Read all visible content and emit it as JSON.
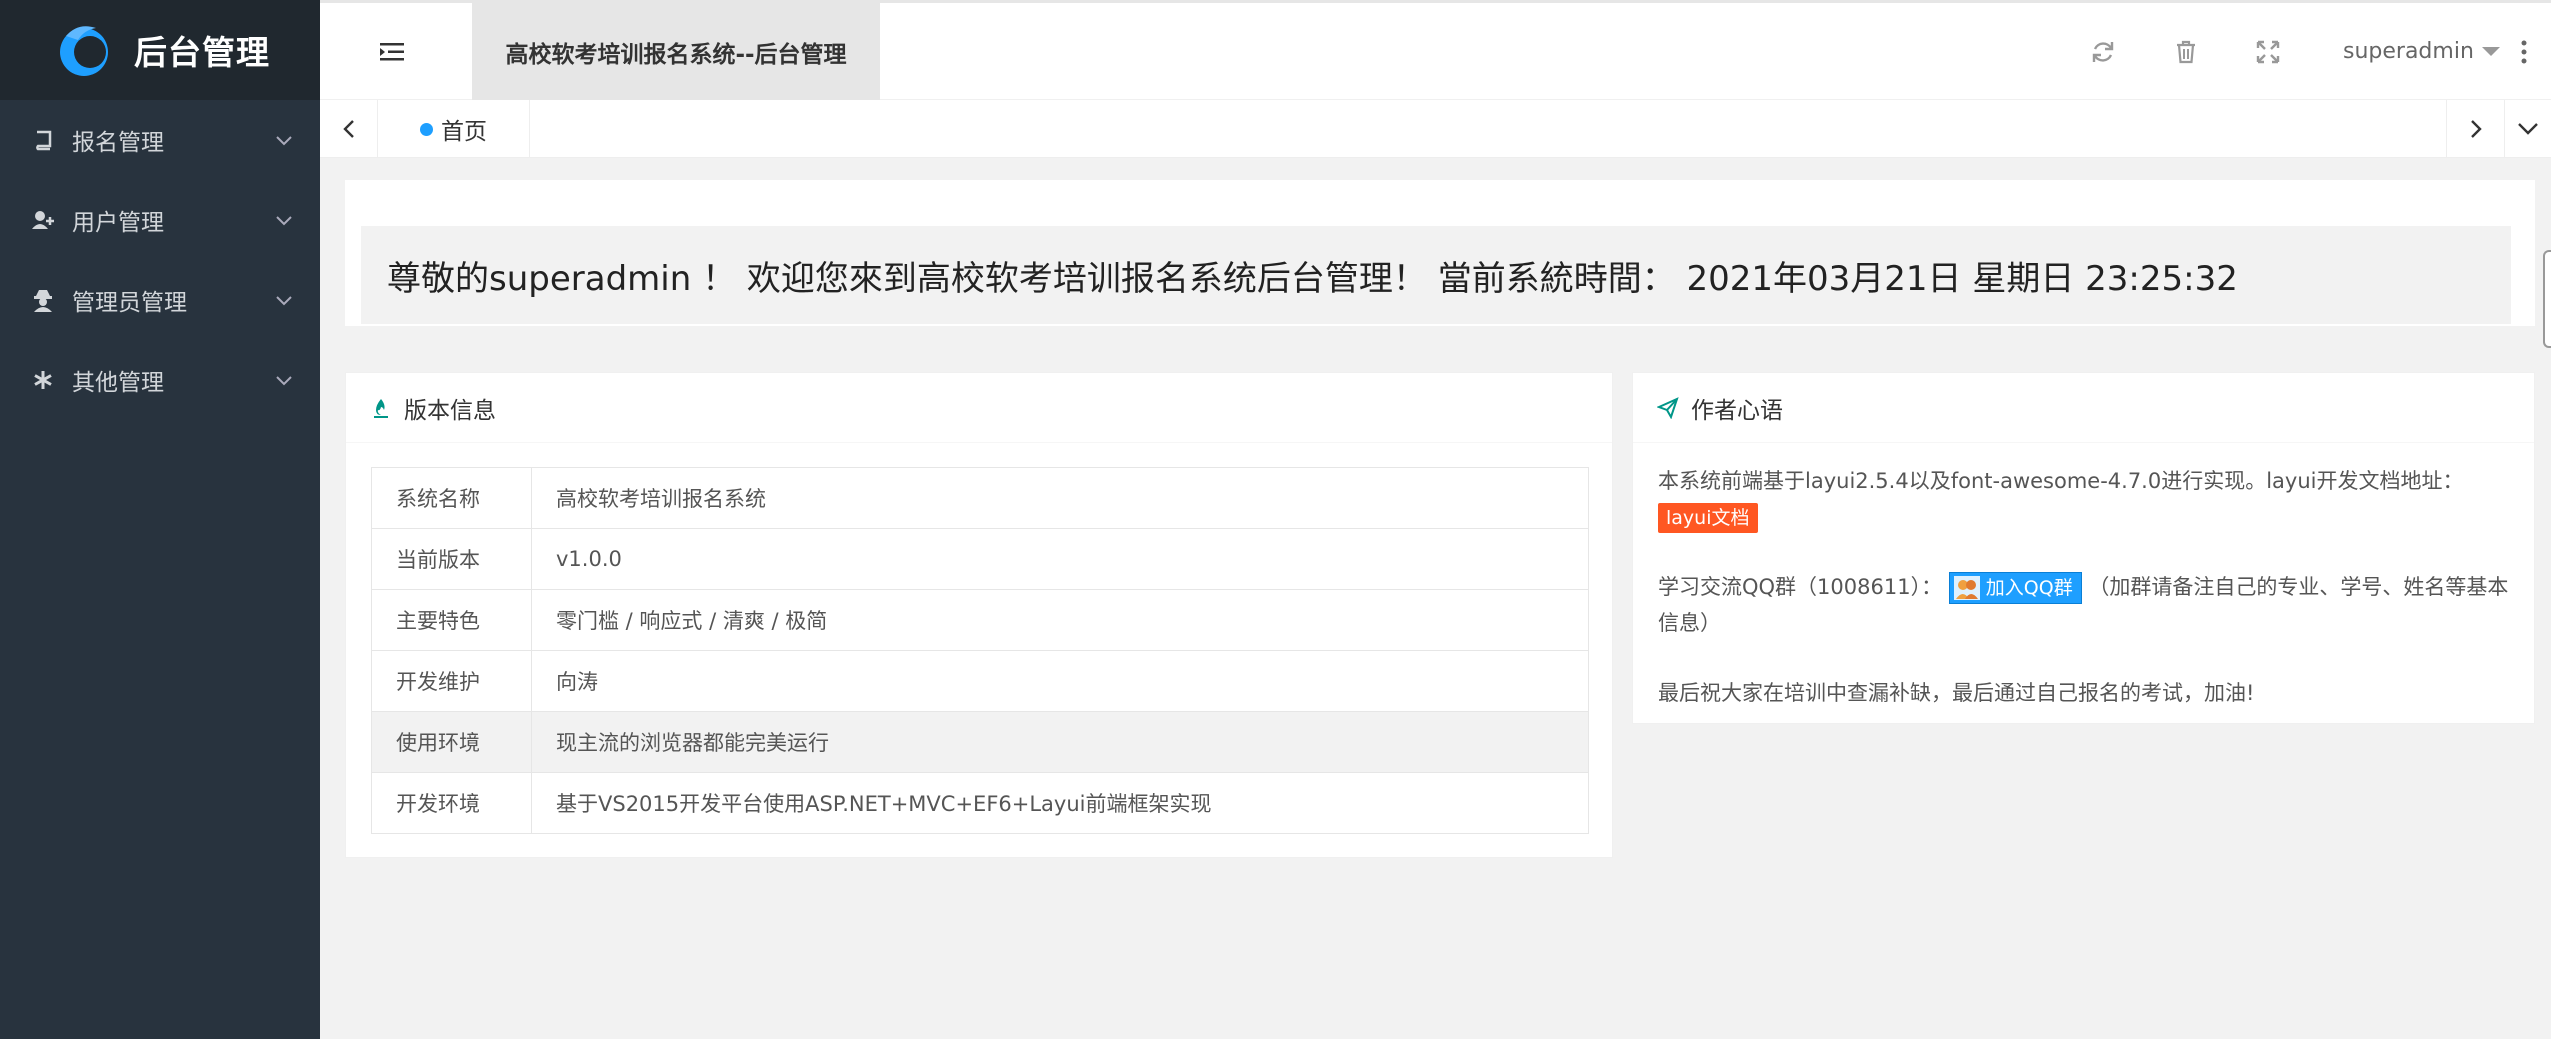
{
  "app": {
    "logo_title": "后台管理",
    "page_title": "高校软考培训报名系统--后台管理"
  },
  "sidebar": {
    "items": [
      {
        "label": "报名管理",
        "icon": "book-icon"
      },
      {
        "label": "用户管理",
        "icon": "user-plus-icon"
      },
      {
        "label": "管理员管理",
        "icon": "user-secret-icon"
      },
      {
        "label": "其他管理",
        "icon": "asterisk-icon"
      }
    ]
  },
  "header": {
    "username": "superadmin",
    "icons": [
      "refresh-icon",
      "trash-icon",
      "fullscreen-icon",
      "more-vertical-icon"
    ]
  },
  "tabs": {
    "home_label": "首页"
  },
  "welcome": {
    "text": "尊敬的superadmin ！ 欢迎您來到高校软考培训报名系统后台管理！ 當前系統時間： 2021年03月21日 星期日 23:25:32"
  },
  "version_card": {
    "title": "版本信息",
    "rows": [
      {
        "key": "系统名称",
        "value": "高校软考培训报名系统"
      },
      {
        "key": "当前版本",
        "value": "v1.0.0"
      },
      {
        "key": "主要特色",
        "value": "零门槛 / 响应式 / 清爽 / 极简"
      },
      {
        "key": "开发维护",
        "value": "向涛"
      },
      {
        "key": "使用环境",
        "value": "现主流的浏览器都能完美运行"
      },
      {
        "key": "开发环境",
        "value": "基于VS2015开发平台使用ASP.NET+MVC+EF6+Layui前端框架实现"
      }
    ]
  },
  "author_card": {
    "title": "作者心语",
    "para1": "本系统前端基于layui2.5.4以及font-awesome-4.7.0进行实现。layui开发文档地址：",
    "doc_link": "layui文档",
    "qq_prefix": "学习交流QQ群（1008611）：",
    "qq_button": "加入QQ群",
    "qq_suffix": "（加群请备注自己的专业、学号、姓名等基本信息）",
    "para3": "最后祝大家在培训中查漏补缺，最后通过自己报名的考试，加油!"
  },
  "colors": {
    "sidebar_bg": "#28333e",
    "logo_bg": "#20282f",
    "accent_blue": "#1e9fff",
    "badge_red": "#ff5722",
    "teal_icon": "#009688"
  }
}
